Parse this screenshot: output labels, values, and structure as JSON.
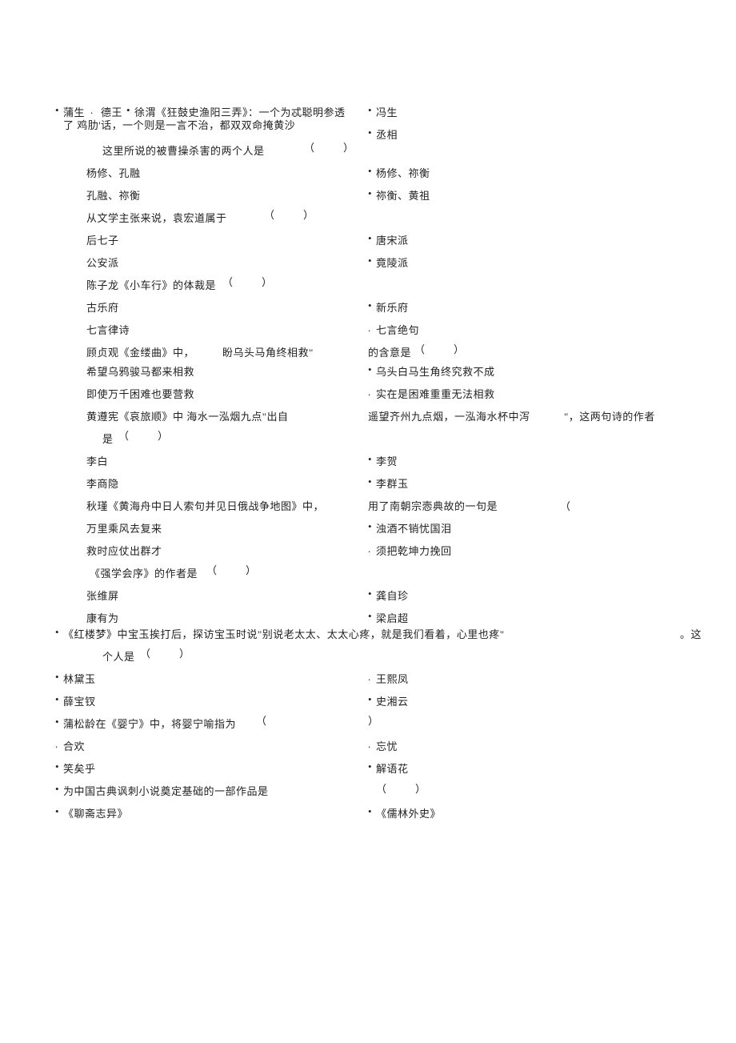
{
  "top": {
    "l1a_prefix": "蒲生",
    "l1a_mid": "德王",
    "l1a_text": "徐渭《狂鼓史渔阳三弄》：一个为忒聪明参透",
    "l1b": "冯生",
    "l2a": "了 鸡肋'话，一个则是一言不治，都双双命掩黄沙",
    "l2b": "丞相"
  },
  "q1": {
    "prompt": "这里所说的被曹操杀害的两个人是",
    "a": "杨修、孔融",
    "b": "杨修、祢衡",
    "c": "孔融、祢衡",
    "d": "祢衡、黄祖"
  },
  "q2": {
    "prompt": "从文学主张来说，袁宏道属于",
    "a": "后七子",
    "b": "唐宋派",
    "c": "公安派",
    "d": "竟陵派"
  },
  "q3": {
    "prompt": "陈子龙《小车行》的体裁是",
    "a": "古乐府",
    "b": "新乐府",
    "c": "七言律诗",
    "d": "七言绝句"
  },
  "q4": {
    "prompt_pre": "顾贞观《金缕曲》中，",
    "prompt_quote": "盼乌头马角终相救\"",
    "prompt_post": "的含意是",
    "a": "希望乌鸦骏马都来相救",
    "b": "乌头白马生角终究救不成",
    "c": "即使万千困难也要营救",
    "d": "实在是困难重重无法相救"
  },
  "q5": {
    "prompt_pre": "黄遵宪《哀旅顺》中 海水一泓烟九点\"出自",
    "prompt_mid": "遥望齐州九点烟，一泓海水杯中泻",
    "prompt_post": "\"，这两句诗的作者",
    "prompt_cont": "是",
    "a": "李白",
    "b": "李贺",
    "c": "李商隐",
    "d": "李群玉"
  },
  "q6": {
    "prompt_pre": "秋瑾《黄海舟中日人索句并见日俄战争地图》中，",
    "prompt_post": "用了南朝宗悫典故的一句是",
    "a": "万里乘风去复来",
    "b": "浊酒不销忧国泪",
    "c": "救时应仗出群才",
    "d": "须把乾坤力挽回"
  },
  "q7": {
    "prompt": "《强学会序》的作者是",
    "a": "张维屏",
    "b": "龚自珍",
    "c": "康有为",
    "d": "梁启超"
  },
  "q8": {
    "prompt_pre": "《红楼梦》中宝玉挨打后，探访宝玉时说\"别说老太太、太太心疼，就是我们看着，心里也疼\"",
    "prompt_post": "。这",
    "prompt_cont": "个人是",
    "a": "林黛玉",
    "b": "王熙凤",
    "c": "薛宝钗",
    "d": "史湘云"
  },
  "q9": {
    "prompt": "蒲松龄在《婴宁》中，将婴宁喻指为",
    "a": "合欢",
    "b": "忘忧",
    "c": "笑矣乎",
    "d": "解语花"
  },
  "q10": {
    "prompt": "为中国古典讽刺小说奠定基础的一部作品是",
    "a": "《聊斋志异》",
    "b": "《儒林外史》"
  },
  "paren": {
    "open": "（",
    "close": "）"
  },
  "dot": "."
}
